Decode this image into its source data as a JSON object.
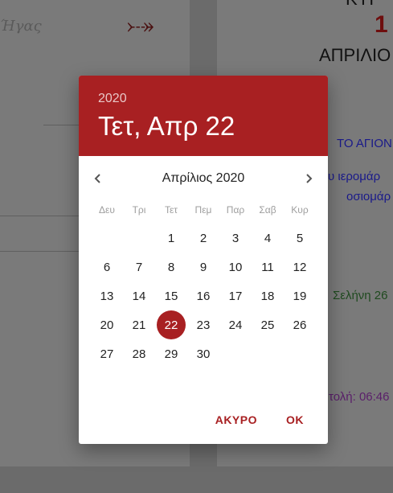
{
  "background": {
    "left_handwriting": "Ήγας",
    "left_arrow": "⤐",
    "right_big_number": "1",
    "right_top_cut": "ΚΥΡ",
    "right_month": "ΑΠΡΙΛΙΟ",
    "right_blue_title": "ΤΟ ΑΓΙΟΝ",
    "right_blue_line1": "υ ιερομάρ",
    "right_blue_line2": "οσιομάρ",
    "right_green": "Σελήνη 26",
    "right_purple": "τολή: 06:46"
  },
  "dialog": {
    "header": {
      "year": "2020",
      "date": "Τετ, Απρ 22",
      "color": "#a82022"
    },
    "month_label": "Απρίλιος 2020",
    "prev_icon": "chevron-left-icon",
    "next_icon": "chevron-right-icon",
    "weekdays": [
      "Δευ",
      "Τρι",
      "Τετ",
      "Πεμ",
      "Παρ",
      "Σαβ",
      "Κυρ"
    ],
    "first_weekday_index": 2,
    "days_in_month": 30,
    "selected_day": 22,
    "cancel_label": "ΑΚΥΡΟ",
    "ok_label": "ΟΚ"
  }
}
